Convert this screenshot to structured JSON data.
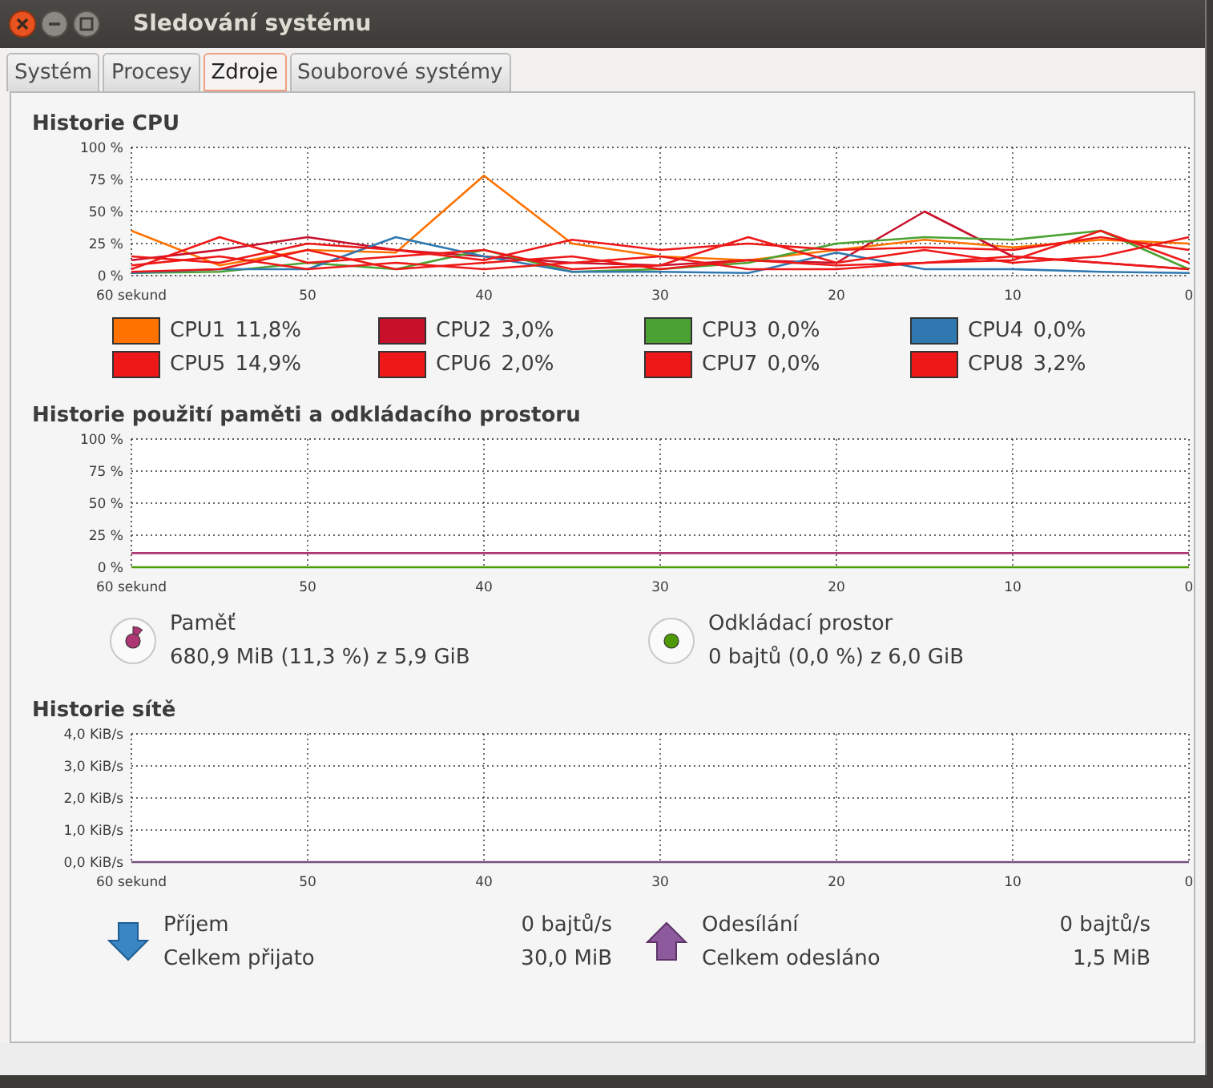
{
  "window": {
    "title": "Sledování systému"
  },
  "tabs": [
    {
      "label": "Systém",
      "selected": false
    },
    {
      "label": "Procesy",
      "selected": false
    },
    {
      "label": "Zdroje",
      "selected": true
    },
    {
      "label": "Souborové systémy",
      "selected": false
    }
  ],
  "cpu": {
    "title": "Historie CPU",
    "chart_data": {
      "type": "line",
      "grid": true,
      "x": [
        60,
        55,
        50,
        45,
        40,
        35,
        30,
        25,
        20,
        15,
        10,
        5,
        0
      ],
      "xlim": [
        60,
        0
      ],
      "ylim": [
        0,
        100
      ],
      "xticks": [
        {
          "value": 60,
          "label": "60 sekund"
        },
        {
          "value": 50,
          "label": "50"
        },
        {
          "value": 40,
          "label": "40"
        },
        {
          "value": 30,
          "label": "30"
        },
        {
          "value": 20,
          "label": "20"
        },
        {
          "value": 10,
          "label": "10"
        },
        {
          "value": 0,
          "label": "0"
        }
      ],
      "yticks": [
        {
          "value": 0,
          "label": "0 %"
        },
        {
          "value": 25,
          "label": "25 %"
        },
        {
          "value": 50,
          "label": "50 %"
        },
        {
          "value": 75,
          "label": "75 %"
        },
        {
          "value": 100,
          "label": "100 %"
        }
      ],
      "series": [
        {
          "color": "#ff7200",
          "values": [
            35,
            8,
            20,
            18,
            78,
            25,
            15,
            12,
            20,
            28,
            22,
            28,
            25
          ]
        },
        {
          "color": "#c8102a",
          "values": [
            12,
            20,
            30,
            20,
            15,
            10,
            8,
            12,
            10,
            50,
            15,
            10,
            5
          ]
        },
        {
          "color": "#4ba232",
          "values": [
            2,
            3,
            10,
            5,
            20,
            3,
            5,
            10,
            25,
            30,
            28,
            35,
            5
          ]
        },
        {
          "color": "#2f78b0",
          "values": [
            2,
            5,
            5,
            30,
            15,
            3,
            3,
            2,
            18,
            5,
            5,
            3,
            2
          ]
        },
        {
          "color": "#ee1818",
          "values": [
            15,
            10,
            25,
            20,
            12,
            28,
            20,
            25,
            20,
            22,
            20,
            30,
            20
          ]
        },
        {
          "color": "#ee1818",
          "values": [
            5,
            30,
            10,
            15,
            20,
            5,
            8,
            30,
            10,
            20,
            10,
            15,
            30
          ]
        },
        {
          "color": "#ee1818",
          "values": [
            8,
            15,
            5,
            10,
            5,
            10,
            15,
            5,
            5,
            10,
            12,
            35,
            10
          ]
        },
        {
          "color": "#ee1818",
          "values": [
            3,
            5,
            20,
            5,
            10,
            15,
            5,
            12,
            8,
            10,
            15,
            10,
            5
          ]
        }
      ]
    },
    "legend": [
      {
        "name": "CPU1",
        "value": "11,8%",
        "color": "#ff7200"
      },
      {
        "name": "CPU2",
        "value": "3,0%",
        "color": "#c8102a"
      },
      {
        "name": "CPU3",
        "value": "0,0%",
        "color": "#4ba232"
      },
      {
        "name": "CPU4",
        "value": "0,0%",
        "color": "#2f78b0"
      },
      {
        "name": "CPU5",
        "value": "14,9%",
        "color": "#ee1818"
      },
      {
        "name": "CPU6",
        "value": "2,0%",
        "color": "#ee1818"
      },
      {
        "name": "CPU7",
        "value": "0,0%",
        "color": "#ee1818"
      },
      {
        "name": "CPU8",
        "value": "3,2%",
        "color": "#ee1818"
      }
    ]
  },
  "memory": {
    "title": "Historie použití paměti a odkládacího prostoru",
    "chart_data": {
      "type": "line",
      "grid": true,
      "x": [
        60,
        0
      ],
      "xlim": [
        60,
        0
      ],
      "ylim": [
        0,
        100
      ],
      "xticks": [
        {
          "value": 60,
          "label": "60 sekund"
        },
        {
          "value": 50,
          "label": "50"
        },
        {
          "value": 40,
          "label": "40"
        },
        {
          "value": 30,
          "label": "30"
        },
        {
          "value": 20,
          "label": "20"
        },
        {
          "value": 10,
          "label": "10"
        },
        {
          "value": 0,
          "label": "0"
        }
      ],
      "yticks": [
        {
          "value": 0,
          "label": "0 %"
        },
        {
          "value": 25,
          "label": "25 %"
        },
        {
          "value": 50,
          "label": "50 %"
        },
        {
          "value": 75,
          "label": "75 %"
        },
        {
          "value": 100,
          "label": "100 %"
        }
      ],
      "series": [
        {
          "color": "#ad3774",
          "values": [
            11,
            11
          ]
        },
        {
          "color": "#4e9a06",
          "values": [
            0,
            0
          ]
        }
      ]
    },
    "legend": [
      {
        "name": "Paměť",
        "detail": "680,9 MiB (11,3 %) z 5,9 GiB",
        "level": 0.113,
        "color": "#ad3774"
      },
      {
        "name": "Odkládací prostor",
        "detail": "0 bajtů (0,0 %) z 6,0 GiB",
        "color": "#4e9a06"
      }
    ]
  },
  "network": {
    "title": "Historie sítě",
    "chart_data": {
      "type": "line",
      "grid": true,
      "x": [
        60,
        0
      ],
      "xlim": [
        60,
        0
      ],
      "ylim": [
        0,
        4
      ],
      "xticks": [
        {
          "value": 60,
          "label": "60 sekund"
        },
        {
          "value": 50,
          "label": "50"
        },
        {
          "value": 40,
          "label": "40"
        },
        {
          "value": 30,
          "label": "30"
        },
        {
          "value": 20,
          "label": "20"
        },
        {
          "value": 10,
          "label": "10"
        },
        {
          "value": 0,
          "label": "0"
        }
      ],
      "yticks": [
        {
          "value": 0,
          "label": "0,0 KiB/s"
        },
        {
          "value": 1,
          "label": "1,0 KiB/s"
        },
        {
          "value": 2,
          "label": "2,0 KiB/s"
        },
        {
          "value": 3,
          "label": "3,0 KiB/s"
        },
        {
          "value": 4,
          "label": "4,0 KiB/s"
        }
      ],
      "series": [
        {
          "color": "#75507b",
          "values": [
            0,
            0
          ]
        }
      ]
    },
    "legend": [
      {
        "kind": "download",
        "label": "Příjem",
        "value": "0 bajtů/s",
        "total_label": "Celkem přijato",
        "total": "30,0 MiB"
      },
      {
        "kind": "upload",
        "label": "Odesílání",
        "value": "0 bajtů/s",
        "total_label": "Celkem odesláno",
        "total": "1,5 MiB"
      }
    ]
  }
}
